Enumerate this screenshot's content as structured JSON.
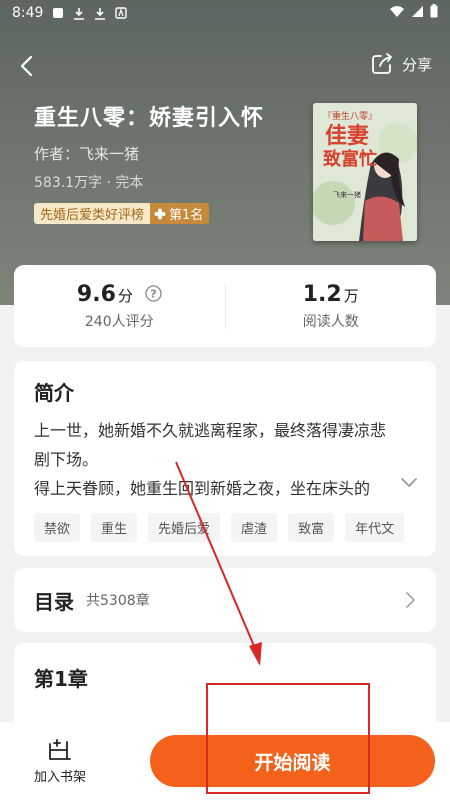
{
  "status_bar": {
    "time": "8:49"
  },
  "nav": {
    "share_label": "分享"
  },
  "book": {
    "title": "重生八零：娇妻引入怀",
    "author": "作者：飞来一猪",
    "meta": "583.1万字 · 完本",
    "rank_list": "先婚后爱类好评榜",
    "rank_position": "第1名",
    "cover": {
      "tag": "『重生八零』",
      "title1": "佳妻",
      "title2": "致富忙",
      "author": "飞来一猪"
    }
  },
  "stats": {
    "score": "9.6",
    "score_unit": "分",
    "score_label": "240人评分",
    "readers": "1.2",
    "readers_unit": "万",
    "readers_label": "阅读人数"
  },
  "intro": {
    "heading": "简介",
    "line1": "上一世，她新婚不久就逃离程家，最终落得凄凉悲",
    "line2": "剧下场。",
    "line3": "得上天眷顾，她重生回到新婚之夜，坐在床头的",
    "tags": [
      "禁欲",
      "重生",
      "先婚后爱",
      "虐渣",
      "致富",
      "年代文"
    ]
  },
  "toc": {
    "title": "目录",
    "count": "共5308章"
  },
  "chapter": {
    "title": "第1章"
  },
  "bottom": {
    "add_shelf": "加入书架",
    "start_reading": "开始阅读"
  },
  "colors": {
    "accent": "#f3611a",
    "annotation": "#d92626"
  }
}
